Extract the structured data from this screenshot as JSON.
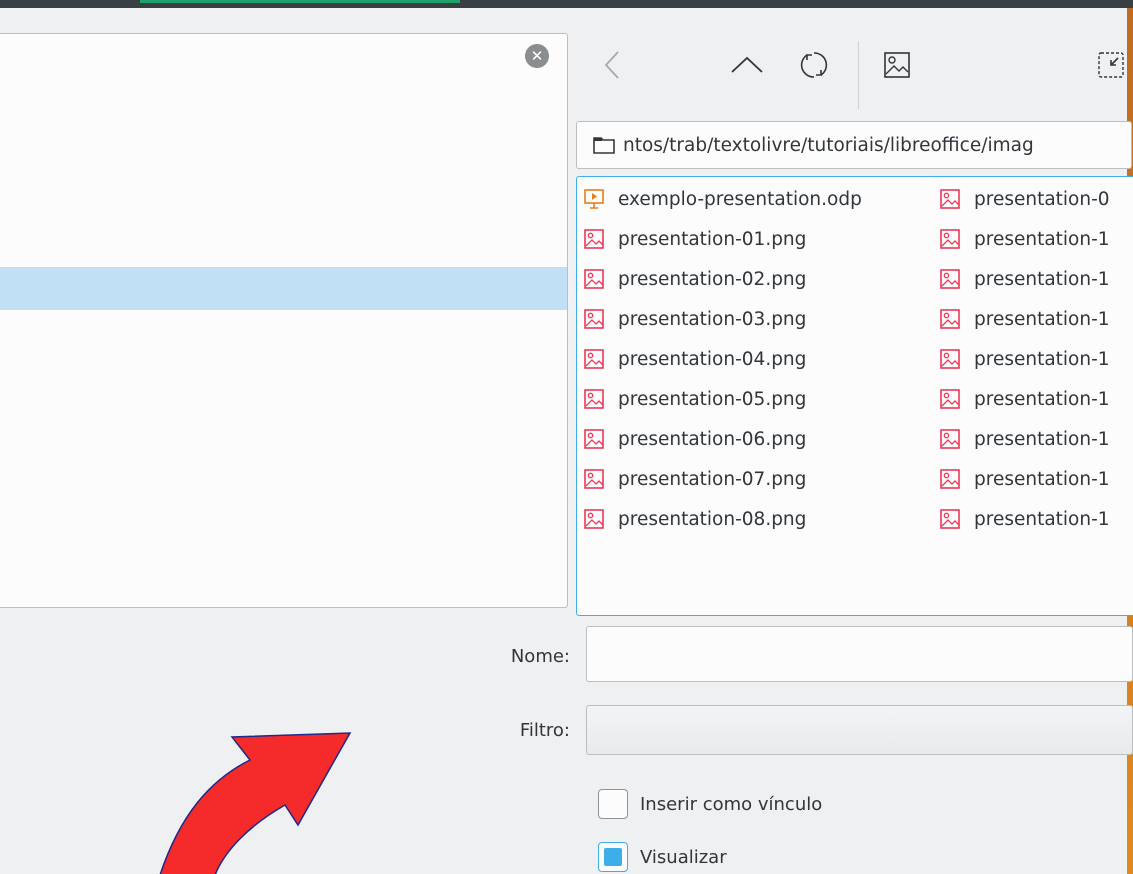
{
  "toolbar": {
    "back_icon": "chevron-left-icon",
    "up_icon": "chevron-up-icon",
    "reload_icon": "reload-icon",
    "preview_icon": "image-preview-icon",
    "shrink_icon": "shrink-icon"
  },
  "search": {
    "clear_icon": "close-circle-icon",
    "clear_glyph": "✕"
  },
  "path": {
    "text": "ntos/trab/textolivre/tutoriais/libreoffice/imag",
    "icon": "folder-icon"
  },
  "files": {
    "column1": [
      {
        "name": "exemplo-presentation.odp",
        "type": "presentation"
      },
      {
        "name": "presentation-01.png",
        "type": "image"
      },
      {
        "name": "presentation-02.png",
        "type": "image"
      },
      {
        "name": "presentation-03.png",
        "type": "image"
      },
      {
        "name": "presentation-04.png",
        "type": "image"
      },
      {
        "name": "presentation-05.png",
        "type": "image"
      },
      {
        "name": "presentation-06.png",
        "type": "image"
      },
      {
        "name": "presentation-07.png",
        "type": "image"
      },
      {
        "name": "presentation-08.png",
        "type": "image"
      }
    ],
    "column2": [
      {
        "name": "presentation-0",
        "type": "image"
      },
      {
        "name": "presentation-1",
        "type": "image"
      },
      {
        "name": "presentation-1",
        "type": "image"
      },
      {
        "name": "presentation-1",
        "type": "image"
      },
      {
        "name": "presentation-1",
        "type": "image"
      },
      {
        "name": "presentation-1",
        "type": "image"
      },
      {
        "name": "presentation-1",
        "type": "image"
      },
      {
        "name": "presentation-1",
        "type": "image"
      },
      {
        "name": "presentation-1",
        "type": "image"
      }
    ]
  },
  "form": {
    "name_label": "Nome:",
    "name_value": "",
    "filter_label": "Filtro:",
    "filter_value": "",
    "insert_link_label": "Inserir como vínculo",
    "insert_link_checked": false,
    "preview_label": "Visualizar",
    "preview_checked": true
  },
  "colors": {
    "accent": "#3daee9",
    "selection": "#c2e0f5",
    "image_icon": "#e93a5a",
    "presentation_icon": "#e67e22",
    "arrow_fill": "#f52a2a",
    "arrow_stroke": "#1c2a8a"
  }
}
